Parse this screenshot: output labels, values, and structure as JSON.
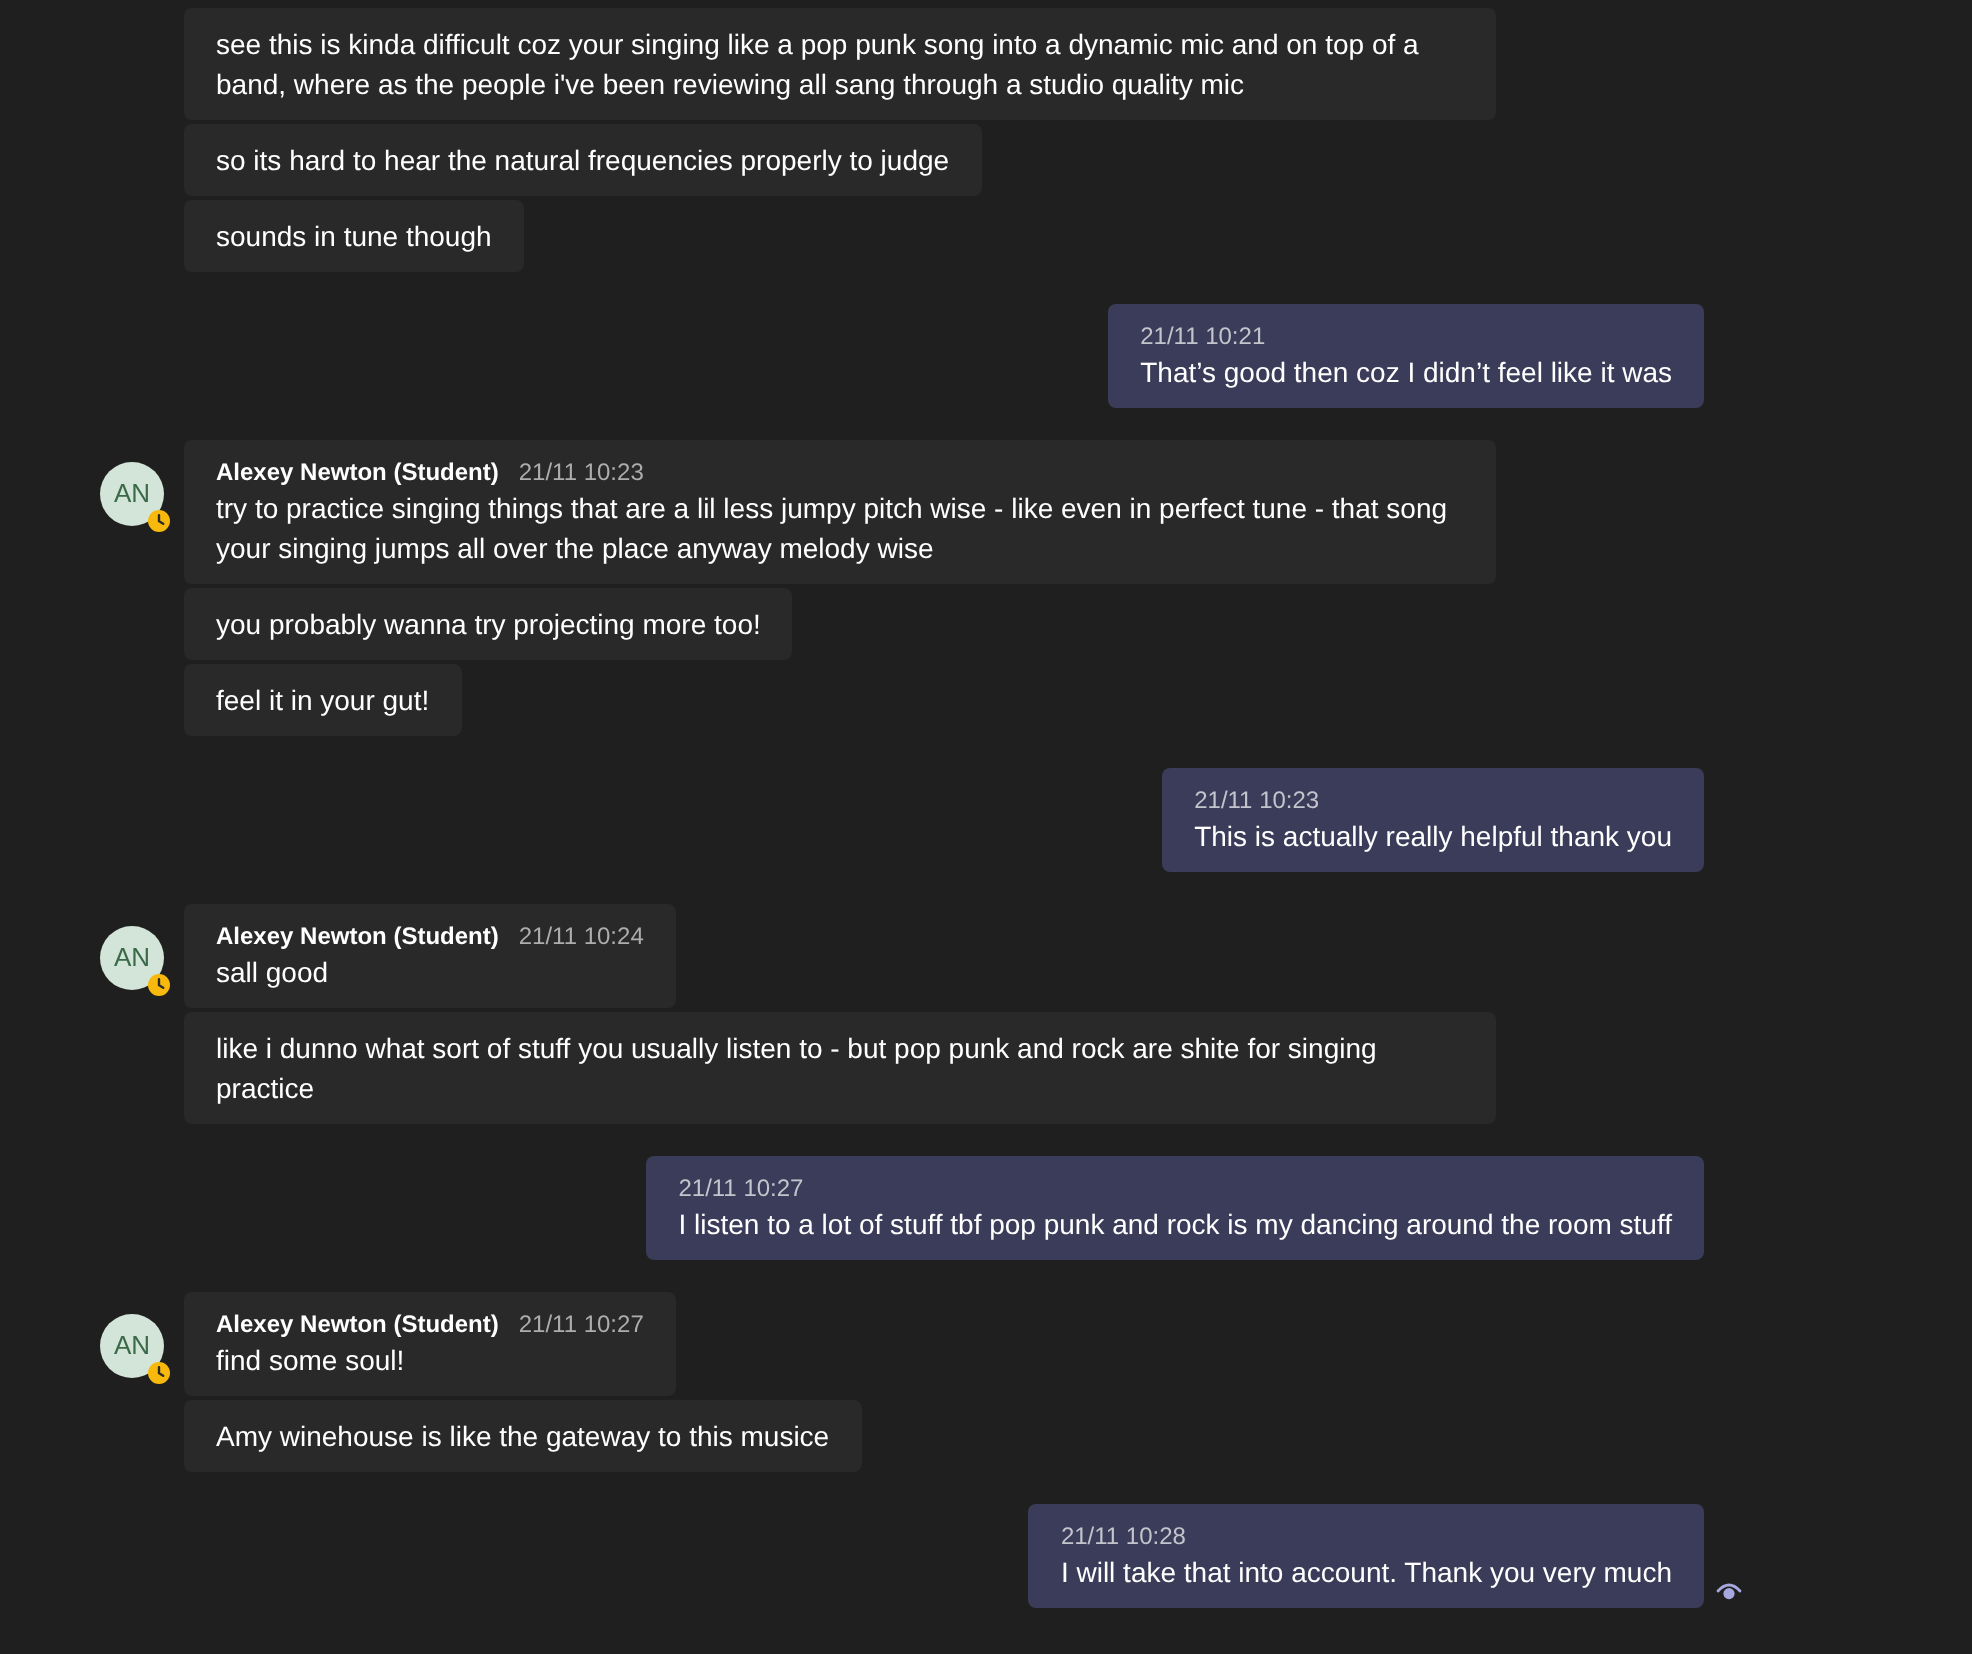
{
  "groups": [
    {
      "kind": "received",
      "bubbles": [
        "see this is kinda difficult coz your singing like a pop punk song into a dynamic mic and on top of a band, where as the people i've been reviewing all sang through a studio quality mic",
        "so its hard to hear the natural frequencies properly to judge",
        "sounds in tune though"
      ]
    },
    {
      "kind": "sent",
      "time": "21/11 10:21",
      "bubbles": [
        "That’s good then coz I didn’t feel like it was"
      ],
      "seen": false
    },
    {
      "kind": "received",
      "avatar": {
        "initials": "AN",
        "away": true
      },
      "author": "Alexey Newton (Student)",
      "time": "21/11 10:23",
      "bubbles": [
        "try to practice singing things that are a lil less jumpy pitch wise - like even in perfect tune - that song your singing jumps all over the place anyway melody wise",
        "you probably wanna try projecting more too!",
        "feel it in your gut!"
      ]
    },
    {
      "kind": "sent",
      "time": "21/11 10:23",
      "bubbles": [
        "This is actually really helpful thank you"
      ],
      "seen": false
    },
    {
      "kind": "received",
      "avatar": {
        "initials": "AN",
        "away": true
      },
      "author": "Alexey Newton (Student)",
      "time": "21/11 10:24",
      "bubbles": [
        "sall good",
        "like i dunno what sort of stuff you usually listen to - but pop punk and rock are shite for singing practice"
      ]
    },
    {
      "kind": "sent",
      "time": "21/11 10:27",
      "bubbles": [
        "I listen to a lot of stuff tbf pop punk and rock is my dancing around the room stuff"
      ],
      "seen": false
    },
    {
      "kind": "received",
      "avatar": {
        "initials": "AN",
        "away": true
      },
      "author": "Alexey Newton (Student)",
      "time": "21/11 10:27",
      "bubbles": [
        "find some soul!",
        "Amy winehouse is like the gateway to this musice"
      ]
    },
    {
      "kind": "sent",
      "time": "21/11 10:28",
      "bubbles": [
        "I will take that into account. Thank you very much"
      ],
      "seen": true
    }
  ]
}
